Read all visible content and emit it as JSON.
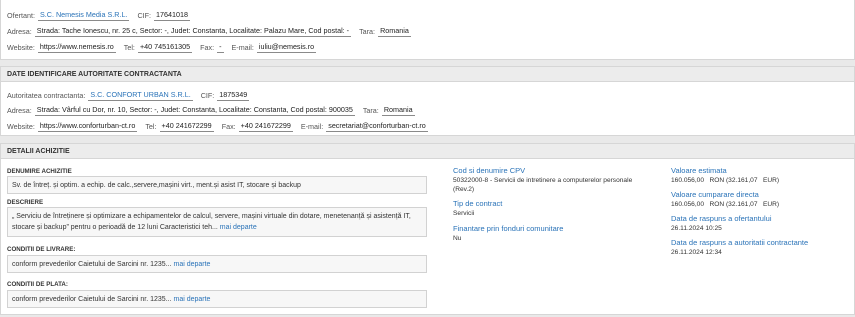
{
  "offerer": {
    "ofertant_label": "Ofertant:",
    "ofertant_value": "S.C. Nemesis Media S.R.L.",
    "cif_label": "CIF:",
    "cif_value": "17641018",
    "adresa_label": "Adresa:",
    "adresa_value": "Strada: Tache Ionescu, nr. 25 c, Sector: -, Judet: Constanta, Localitate: Palazu Mare, Cod postal: -",
    "tara_label": "Tara:",
    "tara_value": "Romania",
    "website_label": "Website:",
    "website_value": "https://www.nemesis.ro",
    "tel_label": "Tel:",
    "tel_value": "+40 745161305",
    "fax_label": "Fax:",
    "fax_value": "-",
    "email_label": "E-mail:",
    "email_value": "iuliu@nemesis.ro"
  },
  "authority": {
    "header": "DATE IDENTIFICARE AUTORITATE CONTRACTANTA",
    "autoritatea_label": "Autoritatea contractanta:",
    "autoritatea_value": "S.C. CONFORT URBAN S.R.L.",
    "cif_label": "CIF:",
    "cif_value": "1875349",
    "adresa_label": "Adresa:",
    "adresa_value": "Strada: Vârful cu Dor, nr. 10, Sector: -, Judet: Constanta, Localitate: Constanta, Cod postal: 900035",
    "tara_label": "Tara:",
    "tara_value": "Romania",
    "website_label": "Website:",
    "website_value": "https://www.conforturban-ct.ro",
    "tel_label": "Tel:",
    "tel_value": "+40 241672299",
    "fax_label": "Fax:",
    "fax_value": "+40 241672299",
    "email_label": "E-mail:",
    "email_value": "secretariat@conforturban-ct.ro"
  },
  "details": {
    "header": "DETALII ACHIZITIE",
    "denumire_label": "DENUMIRE ACHIZITIE",
    "denumire_value": "Sv. de întreț. și optim. a echip. de calc.,servere,mașini virt., ment.și asist IT, stocare și backup",
    "descriere_label": "DESCRIERE",
    "descriere_value": "„ Serviciu de întreținere și optimizare a echipamentelor de calcul, servere, mașini virtuale din dotare, menetenanță și asistență IT, stocare și backup” pentru o perioadă de 12 luni Caracteristici teh...",
    "more_label": "mai departe",
    "livrare_label": "CONDITII DE LIVRARE:",
    "livrare_value": "conform prevederilor Caietului de Sarcini nr. 1235...",
    "plata_label": "CONDITII DE PLATA:",
    "plata_value": "conform prevederilor Caietului de Sarcini nr. 1235...",
    "cpv_title": "Cod si denumire CPV",
    "cpv_value": "50322000-8 - Servicii de intretinere a computerelor personale (Rev.2)",
    "tip_title": "Tip de contract",
    "tip_value": "Servicii",
    "fin_title": "Finantare prin fonduri comunitare",
    "fin_value": "Nu",
    "val_est_title": "Valoare estimata",
    "val_est_value": "160.056,00   RON (32.161,07   EUR)",
    "val_cump_title": "Valoare cumparare directa",
    "val_cump_value": "160.056,00   RON (32.161,07   EUR)",
    "data_of_title": "Data de raspuns a ofertantului",
    "data_of_value": "26.11.2024 10:25",
    "data_aut_title": "Data de raspuns a autoritatii contractante",
    "data_aut_value": "26.11.2024 12:34"
  }
}
